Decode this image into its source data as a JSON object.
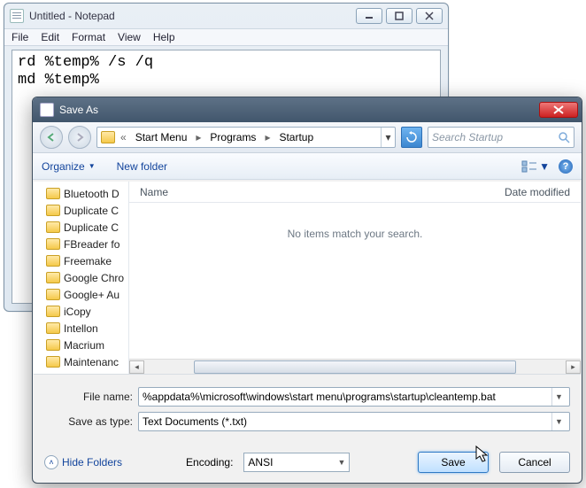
{
  "notepad": {
    "title": "Untitled - Notepad",
    "menus": {
      "file": "File",
      "edit": "Edit",
      "format": "Format",
      "view": "View",
      "help": "Help"
    },
    "content": "rd %temp% /s /q\nmd %temp%"
  },
  "saveas": {
    "title": "Save As",
    "breadcrumb": {
      "seg1": "Start Menu",
      "seg2": "Programs",
      "seg3": "Startup"
    },
    "search_placeholder": "Search Startup",
    "toolbar": {
      "organize": "Organize",
      "newfolder": "New folder"
    },
    "columns": {
      "name": "Name",
      "date": "Date modified"
    },
    "empty_msg": "No items match your search.",
    "tree": [
      "Bluetooth D",
      "Duplicate C",
      "Duplicate C",
      "FBreader fo",
      "Freemake",
      "Google Chro",
      "Google+ Au",
      "iCopy",
      "Intellon",
      "Macrium",
      "Maintenanc"
    ],
    "filename_label": "File name:",
    "filename_value": "%appdata%\\microsoft\\windows\\start menu\\programs\\startup\\cleantemp.bat",
    "saveastype_label": "Save as type:",
    "saveastype_value": "Text Documents (*.txt)",
    "hidefolders": "Hide Folders",
    "encoding_label": "Encoding:",
    "encoding_value": "ANSI",
    "save_btn": "Save",
    "cancel_btn": "Cancel"
  }
}
